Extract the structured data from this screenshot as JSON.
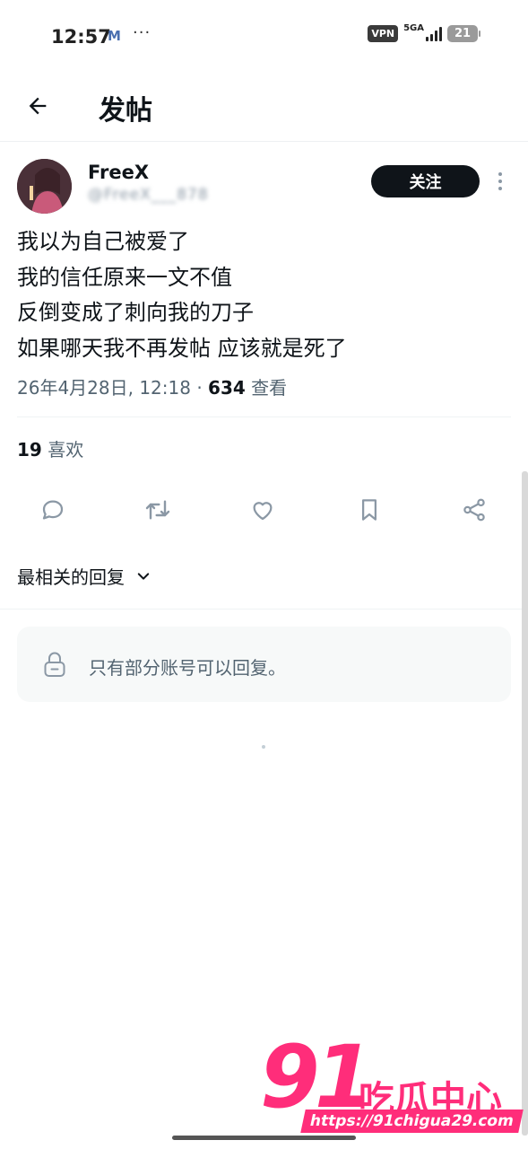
{
  "status_bar": {
    "time": "12:57",
    "notification_app": "M",
    "more_indicator": "···",
    "vpn": "VPN",
    "network": "5GA",
    "battery": "21"
  },
  "header": {
    "title": "发帖",
    "back_icon": "arrow-left-icon"
  },
  "post": {
    "author_name": "FreeX",
    "author_handle": "@FreeX___878",
    "follow_label": "关注",
    "lines": [
      "我以为自己被爱了",
      "我的信任原来一文不值",
      "反倒变成了刺向我的刀子",
      "如果哪天我不再发帖 应该就是死了"
    ],
    "timestamp": "26年4月28日, 12:18 · ",
    "views_count": "634",
    "views_label": " 查看",
    "likes_count": "19",
    "likes_label": " 喜欢"
  },
  "actions": [
    "reply-icon",
    "retweet-icon",
    "like-icon",
    "bookmark-icon",
    "share-icon"
  ],
  "replies": {
    "sort_label": "最相关的回复",
    "restricted_text": "只有部分账号可以回复。"
  },
  "watermark": {
    "number": "91",
    "name": "吃瓜中心",
    "url": "https://91chigua29.com"
  },
  "colors": {
    "text_primary": "#0f1419",
    "text_secondary": "#536471",
    "icon_gray": "#8b98a5",
    "button_dark": "#0f1419",
    "watermark_pink": "#ff2d7a"
  }
}
